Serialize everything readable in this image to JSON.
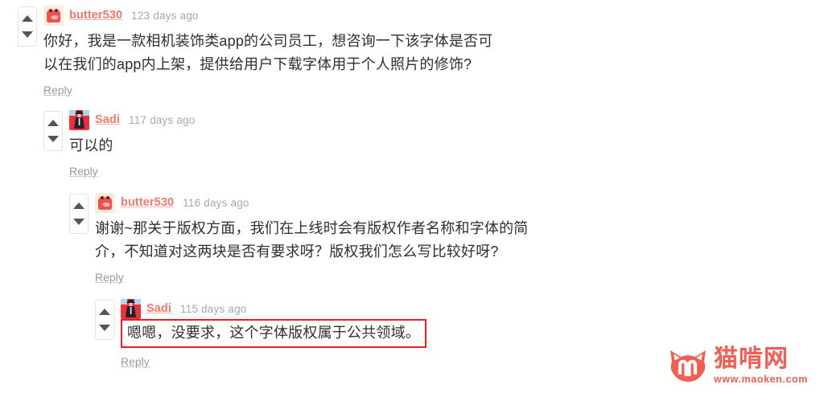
{
  "page": {
    "background_color": "#ffffff",
    "link_color": "#f4796b",
    "text_color": "#2f2f2f",
    "muted_color": "#a8a8a8",
    "highlight_color": "#ee1c25"
  },
  "vote": {
    "up_icon": "triangle-up-icon",
    "down_icon": "triangle-down-icon",
    "arrow_color": "#555555"
  },
  "comments": [
    {
      "level": 1,
      "avatar_icon": "butter530-red-blob-avatar",
      "username": "butter530",
      "timestamp": "123 days ago",
      "body": "你好，我是一款相机装饰类app的公司员工，想咨询一下该字体是否可以在我们的app内上架，提供给用户下载字体用于个人照片的修饰?",
      "reply_label": "Reply",
      "highlighted": false
    },
    {
      "level": 2,
      "avatar_icon": "sadi-figure-avatar",
      "username": "Sadi",
      "timestamp": "117 days ago",
      "body": "可以的",
      "reply_label": "Reply",
      "highlighted": false
    },
    {
      "level": 3,
      "avatar_icon": "butter530-red-blob-avatar",
      "username": "butter530",
      "timestamp": "116 days ago",
      "body": "谢谢~那关于版权方面，我们在上线时会有版权作者名称和字体的简介，不知道对这两块是否有要求呀？版权我们怎么写比较好呀?",
      "reply_label": "Reply",
      "highlighted": false
    },
    {
      "level": 4,
      "avatar_icon": "sadi-figure-avatar",
      "username": "Sadi",
      "timestamp": "115 days ago",
      "body": "嗯嗯，没要求，这个字体版权属于公共领域。",
      "reply_label": "Reply",
      "highlighted": true
    }
  ],
  "watermark": {
    "logo_icon": "cat-head-m-logo-icon",
    "site_name": "猫啃网",
    "site_url": "www.maoken.com",
    "color": "#f4574c"
  }
}
